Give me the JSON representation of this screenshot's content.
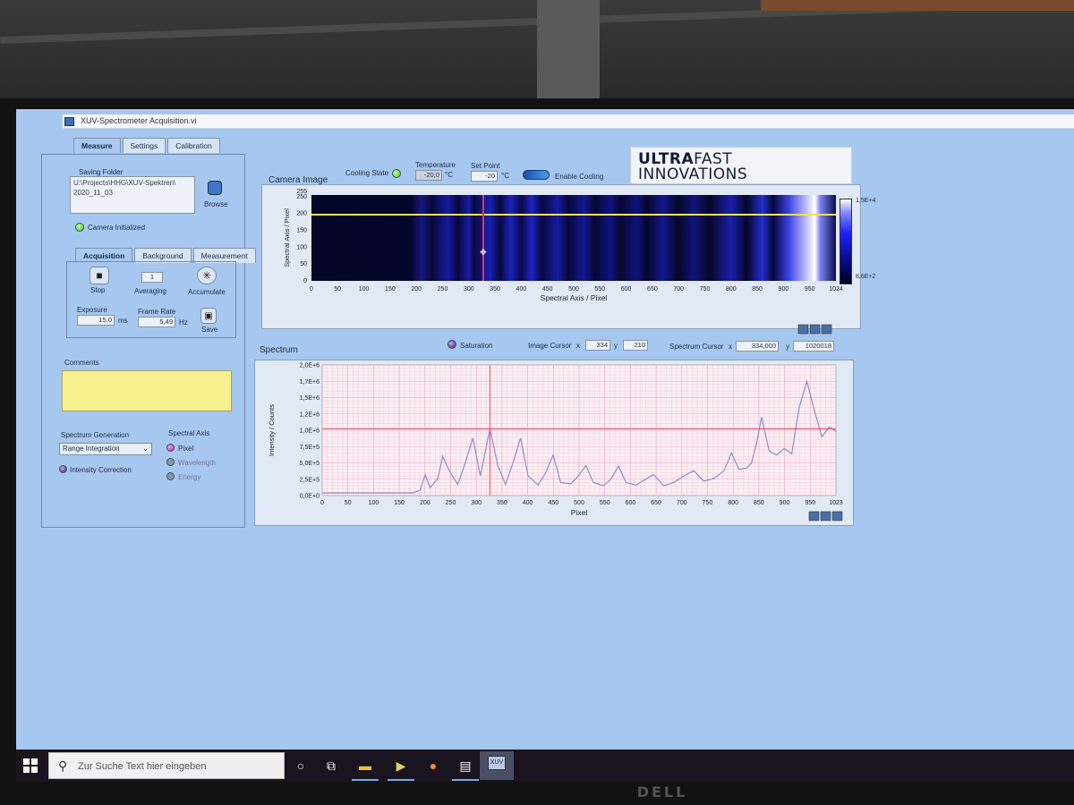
{
  "window": {
    "title": "XUV-Spectrometer Acquisition.vi"
  },
  "main_tabs": [
    "Measure",
    "Settings",
    "Calibration"
  ],
  "saving": {
    "label": "Saving Folder",
    "path_line1": "U:\\Projects\\HHG\\XUV-Spektren\\",
    "path_line2": "2020_11_03",
    "browse": "Browse"
  },
  "camera_status": "Camera Initialized",
  "sub_tabs": [
    "Acquisition",
    "Background",
    "Measurement"
  ],
  "acquisition": {
    "stop": "Stop",
    "averaging_label": "Averaging",
    "averaging_value": "1",
    "accumulate": "Accumulate",
    "exposure_label": "Exposure",
    "exposure_value": "15,0",
    "exposure_unit": "ms",
    "frame_rate_label": "Frame Rate",
    "frame_rate_value": "5,49",
    "frame_rate_unit": "Hz",
    "save": "Save"
  },
  "comments_label": "Comments",
  "spectrum_generation": {
    "label": "Spectrum Generation",
    "selected": "Range Integration",
    "intensity_correction": "Intensity Correction"
  },
  "spectral_axis": {
    "label": "Spectral Axis",
    "options": [
      "Pixel",
      "Wavelength",
      "Energy"
    ],
    "selected": "Pixel"
  },
  "camera": {
    "title": "Camera Image",
    "cooling_state": "Cooling State",
    "temperature_label": "Temperature",
    "temperature_value": "-20,0",
    "set_point_label": "Set Point",
    "set_point_value": "-20",
    "unit": "°C",
    "enable_cooling": "Enable Cooling",
    "xlabel": "Spectral Axis / Pixel",
    "ylabel": "Spectral Axis / Pixel",
    "x_ticks": [
      "0",
      "50",
      "100",
      "150",
      "200",
      "250",
      "300",
      "350",
      "400",
      "450",
      "500",
      "550",
      "600",
      "650",
      "700",
      "750",
      "800",
      "850",
      "900",
      "950",
      "1024"
    ],
    "y_ticks": [
      "250",
      "200",
      "150",
      "100",
      "50",
      "0"
    ],
    "y_top": "255",
    "colorbar_max": "1,5E+4",
    "colorbar_min": "8,6E+2"
  },
  "spectrum": {
    "title": "Spectrum",
    "saturation": "Saturation",
    "image_cursor_label": "Image Cursor",
    "image_cursor_x": "334",
    "image_cursor_y": "210",
    "spectrum_cursor_label": "Spectrum Cursor",
    "spectrum_cursor_x": "334,000",
    "spectrum_cursor_y": "1020018",
    "x_letter": "x",
    "y_letter": "y"
  },
  "chart_data": {
    "type": "line",
    "xlabel": "Pixel",
    "ylabel": "Intensity / Counts",
    "xlim": [
      0,
      1023
    ],
    "ylim": [
      0,
      2000000
    ],
    "x_ticks": [
      "0",
      "50",
      "100",
      "150",
      "200",
      "250",
      "300",
      "350",
      "400",
      "450",
      "500",
      "550",
      "600",
      "650",
      "700",
      "750",
      "800",
      "850",
      "900",
      "950",
      "1023"
    ],
    "y_ticks": [
      "0,0E+0",
      "2,5E+5",
      "5,0E+5",
      "7,5E+5",
      "1,0E+6",
      "1,2E+6",
      "1,5E+6",
      "1,7E+6",
      "2,0E+6"
    ],
    "cursor_x": 334,
    "cursor_y": 1020018,
    "series": [
      {
        "x": [
          0,
          50,
          100,
          150,
          180,
          195,
          205,
          215,
          230,
          240,
          255,
          270,
          285,
          300,
          315,
          334,
          350,
          365,
          380,
          395,
          410,
          430,
          445,
          460,
          475,
          495,
          510,
          525,
          540,
          560,
          575,
          590,
          605,
          625,
          640,
          660,
          680,
          700,
          720,
          740,
          760,
          780,
          800,
          815,
          830,
          845,
          855,
          865,
          875,
          890,
          905,
          920,
          935,
          950,
          965,
          980,
          995,
          1010,
          1023
        ],
        "y": [
          40000,
          40000,
          40000,
          40000,
          40000,
          80000,
          320000,
          120000,
          260000,
          600000,
          350000,
          170000,
          500000,
          880000,
          300000,
          1020000,
          450000,
          170000,
          500000,
          880000,
          300000,
          160000,
          350000,
          620000,
          200000,
          180000,
          300000,
          460000,
          200000,
          150000,
          250000,
          450000,
          200000,
          160000,
          230000,
          320000,
          150000,
          200000,
          300000,
          380000,
          220000,
          260000,
          380000,
          650000,
          400000,
          420000,
          500000,
          800000,
          1200000,
          680000,
          620000,
          720000,
          640000,
          1350000,
          1750000,
          1300000,
          900000,
          1050000,
          980000
        ]
      }
    ]
  },
  "taskbar": {
    "search_placeholder": "Zur Suche Text hier eingeben",
    "active_app": "XUV"
  },
  "logo": {
    "line1_bold": "ULTRA",
    "line1_rest": "FAST",
    "line2": "INNOVATIONS"
  },
  "colors": {
    "background": "#a6c7ef",
    "plot_bg": "#fbeff4",
    "trace": "#8d8fc8",
    "cursor": "#e05263"
  }
}
